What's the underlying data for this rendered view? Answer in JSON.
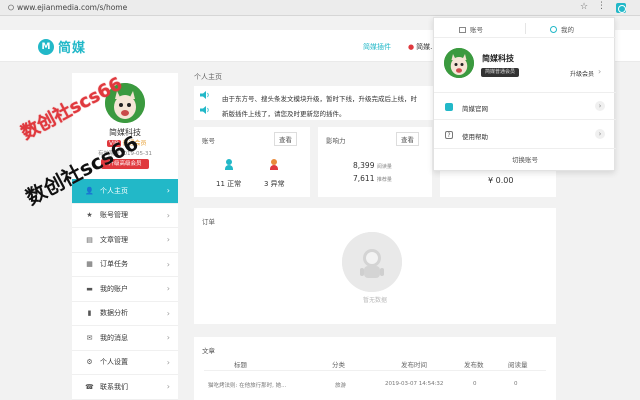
{
  "browser": {
    "url": "www.ejianmedia.com/s/home"
  },
  "header": {
    "logo_mark": "M",
    "logo_text": "简媒",
    "nav": [
      "简媒插件",
      "简媒..."
    ]
  },
  "sidebar": {
    "user_name": "简媒科技",
    "vip_badge": "VIP",
    "vip_level": "普通会员",
    "expiry": "有效期至2019-05-31",
    "upgrade_label": "升级高级会员",
    "items": [
      {
        "icon": "user-icon",
        "glyph": "👤",
        "label": "个人主页"
      },
      {
        "icon": "star-icon",
        "glyph": "★",
        "label": "账号管理"
      },
      {
        "icon": "doc-icon",
        "glyph": "▤",
        "label": "文章管理"
      },
      {
        "icon": "calendar-icon",
        "glyph": "▦",
        "label": "订单任务"
      },
      {
        "icon": "wallet-icon",
        "glyph": "▬",
        "label": "我的账户"
      },
      {
        "icon": "chart-icon",
        "glyph": "▮",
        "label": "数据分析"
      },
      {
        "icon": "message-icon",
        "glyph": "✉",
        "label": "我的消息"
      },
      {
        "icon": "settings-icon",
        "glyph": "⚙",
        "label": "个人设置"
      },
      {
        "icon": "contact-icon",
        "glyph": "☎",
        "label": "联系我们"
      }
    ]
  },
  "watermark": {
    "line1": "数创社scs66",
    "line2": "数创社scs66"
  },
  "main": {
    "breadcrumb": "个人主页",
    "notice": {
      "line1": "由于东方号、搜头条发文模块升级，暂时下线，升级完成后上线，时",
      "line2": "新版插件上线了，请您及时更新您的插件。"
    },
    "account_card": {
      "title": "账号",
      "check": "查看",
      "normal": "11 正常",
      "abnormal": "3 异常"
    },
    "influence_card": {
      "title": "影响力",
      "check": "查看",
      "read_value": "8,399",
      "read_label": "阅读量",
      "rec_value": "7,611",
      "rec_label": "推荐量"
    },
    "balance_card": {
      "value": "¥ 0.00"
    },
    "order_card": {
      "title": "订单",
      "empty_text": "暂无数据"
    },
    "article_card": {
      "title": "文章",
      "columns": [
        "标题",
        "分类",
        "发布时间",
        "发布数",
        "阅读量"
      ],
      "row": [
        "猫吃烤法则: 在他旅行那时, 她...",
        "旅游",
        "2019-03-07 14:54:32",
        "0",
        "0"
      ]
    }
  },
  "popup": {
    "tab_account": "账号",
    "tab_mine": "我的",
    "user_name": "简媒科技",
    "member_badge": "简媒普通会员",
    "upgrade_label": "升级会员",
    "official_site": "简媒官网",
    "help": "使用帮助",
    "help_glyph": "?",
    "switch_account": "切换账号"
  },
  "colors": {
    "accent": "#22b8c8",
    "vip_red": "#e0393e",
    "page_bg": "#f2f2f2"
  }
}
